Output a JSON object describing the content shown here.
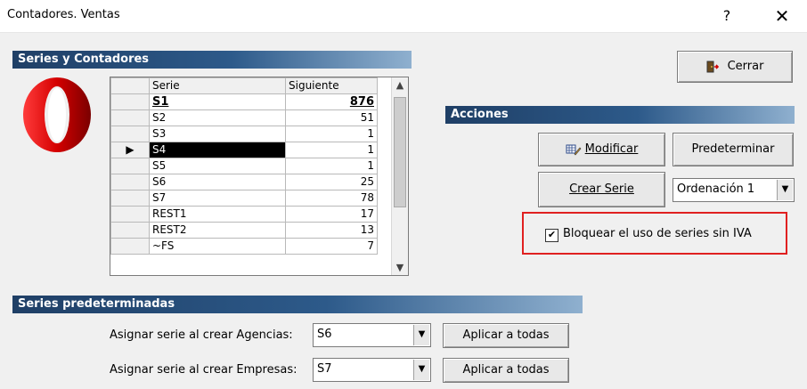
{
  "window": {
    "title": "Contadores. Ventas",
    "help_label": "?",
    "close_label": "✕"
  },
  "series_panel": {
    "title": "Series y Contadores",
    "columns": [
      "Serie",
      "Siguiente"
    ],
    "rows": [
      {
        "serie": "S1",
        "siguiente": "876"
      },
      {
        "serie": "S2",
        "siguiente": "51"
      },
      {
        "serie": "S3",
        "siguiente": "1"
      },
      {
        "serie": "S4",
        "siguiente": "1"
      },
      {
        "serie": "S5",
        "siguiente": "1"
      },
      {
        "serie": "S6",
        "siguiente": "25"
      },
      {
        "serie": "S7",
        "siguiente": "78"
      },
      {
        "serie": "REST1",
        "siguiente": "17"
      },
      {
        "serie": "REST2",
        "siguiente": "13"
      },
      {
        "serie": "~FS",
        "siguiente": "7"
      }
    ],
    "selected_row_marker": "▶"
  },
  "actions": {
    "title": "Acciones",
    "close_button": "Cerrar",
    "modify_button": "Modificar",
    "default_button": "Predeterminar",
    "create_button": "Crear Serie",
    "order_select": "Ordenación 1",
    "block_checkbox_label": "Bloquear el uso de series sin IVA",
    "block_checkbox_checked": true
  },
  "defaults": {
    "title": "Series predeterminadas",
    "agencies_label": "Asignar serie al crear Agencias:",
    "agencies_value": "S6",
    "companies_label": "Asignar serie al crear Empresas:",
    "companies_value": "S7",
    "apply_all_label": "Aplicar a todas"
  },
  "colors": {
    "header_bar": "#1f3f66",
    "highlight_box": "#e02020",
    "selection": "#000000"
  }
}
